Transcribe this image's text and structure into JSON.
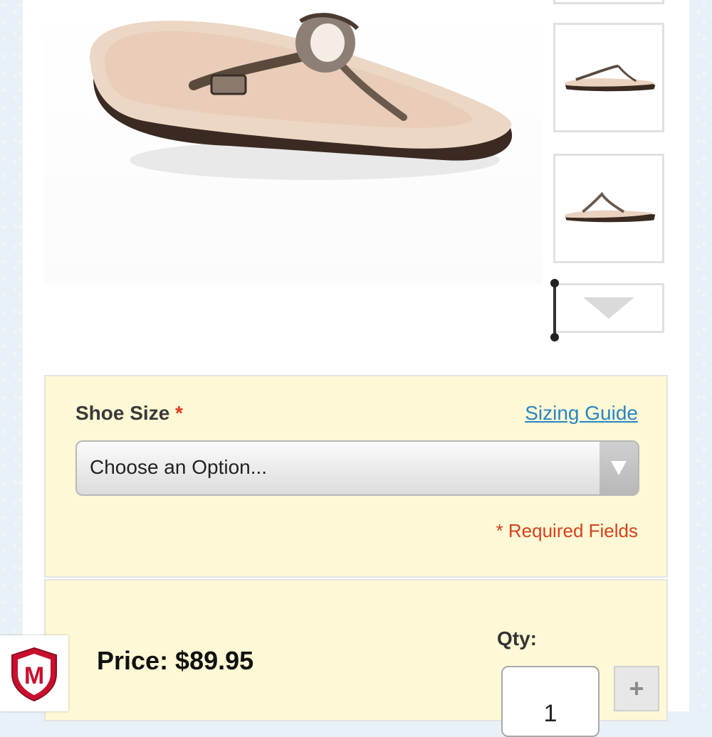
{
  "product": {
    "main_image_alt": "",
    "thumbnails": [
      "",
      ""
    ]
  },
  "options": {
    "size_label": "Shoe Size",
    "required_mark": "*",
    "sizing_guide": "Sizing Guide",
    "select_value": "Choose an Option...",
    "required_fields": "* Required Fields"
  },
  "purchase": {
    "price": "Price: $89.95",
    "qty_label": "Qty:",
    "qty_value": "1",
    "plus_label": "+"
  },
  "badge": {
    "letter": "M",
    "icon": "mcafee-shield-icon"
  },
  "colors": {
    "accent_link": "#2a85c4",
    "required": "#d4411e",
    "panel_bg": "#fdf8d5"
  }
}
